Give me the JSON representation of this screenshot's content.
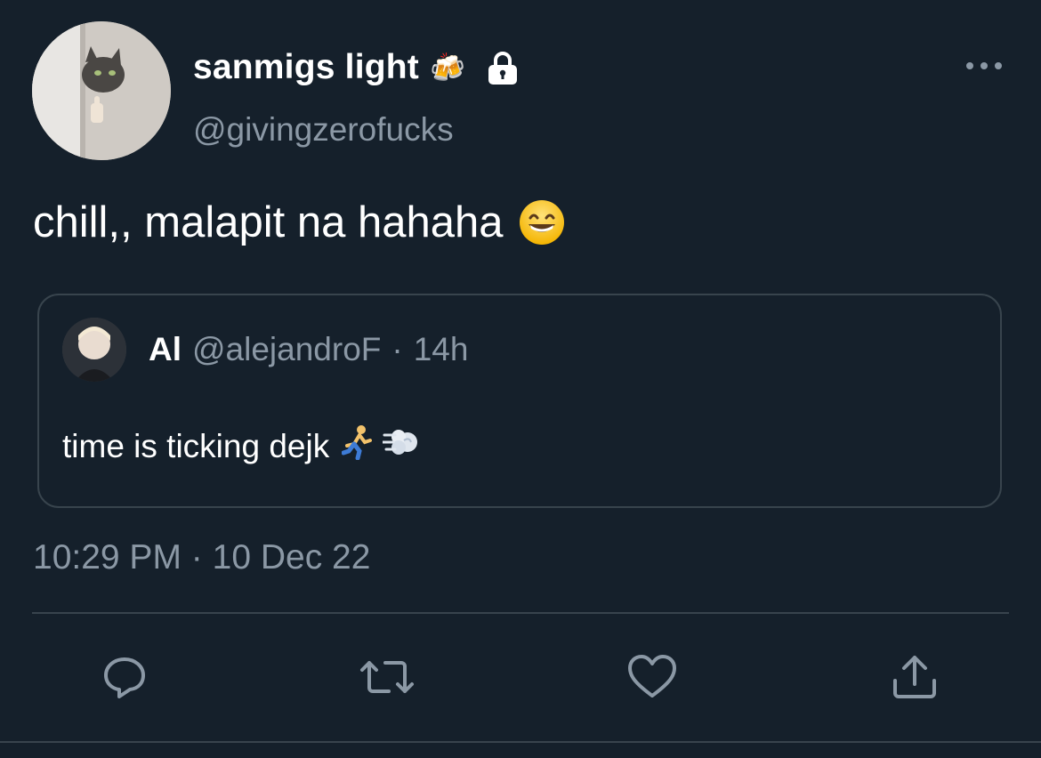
{
  "tweet": {
    "author": {
      "display_name": "sanmigs light",
      "name_emoji": "🍻",
      "handle": "@givingzerofucks",
      "protected": true,
      "avatar_icon": "cat-avatar"
    },
    "text": "chill,, malapit na hahaha",
    "text_emoji": "grinning-face",
    "timestamp": "10:29 PM",
    "date": "10 Dec 22",
    "timestamp_separator": "·"
  },
  "quoted_tweet": {
    "display_name": "Al",
    "handle": "@alejandroF",
    "separator": "·",
    "time_ago": "14h",
    "text": "time is ticking dejk",
    "emojis": [
      "person-running-icon",
      "dash-icon"
    ]
  },
  "actions": [
    {
      "name": "reply-icon"
    },
    {
      "name": "retweet-icon"
    },
    {
      "name": "like-icon"
    },
    {
      "name": "share-icon"
    }
  ],
  "colors": {
    "background": "#15202b",
    "primary_text": "#ffffff",
    "secondary_text": "#8b98a5",
    "border": "#38444d"
  }
}
